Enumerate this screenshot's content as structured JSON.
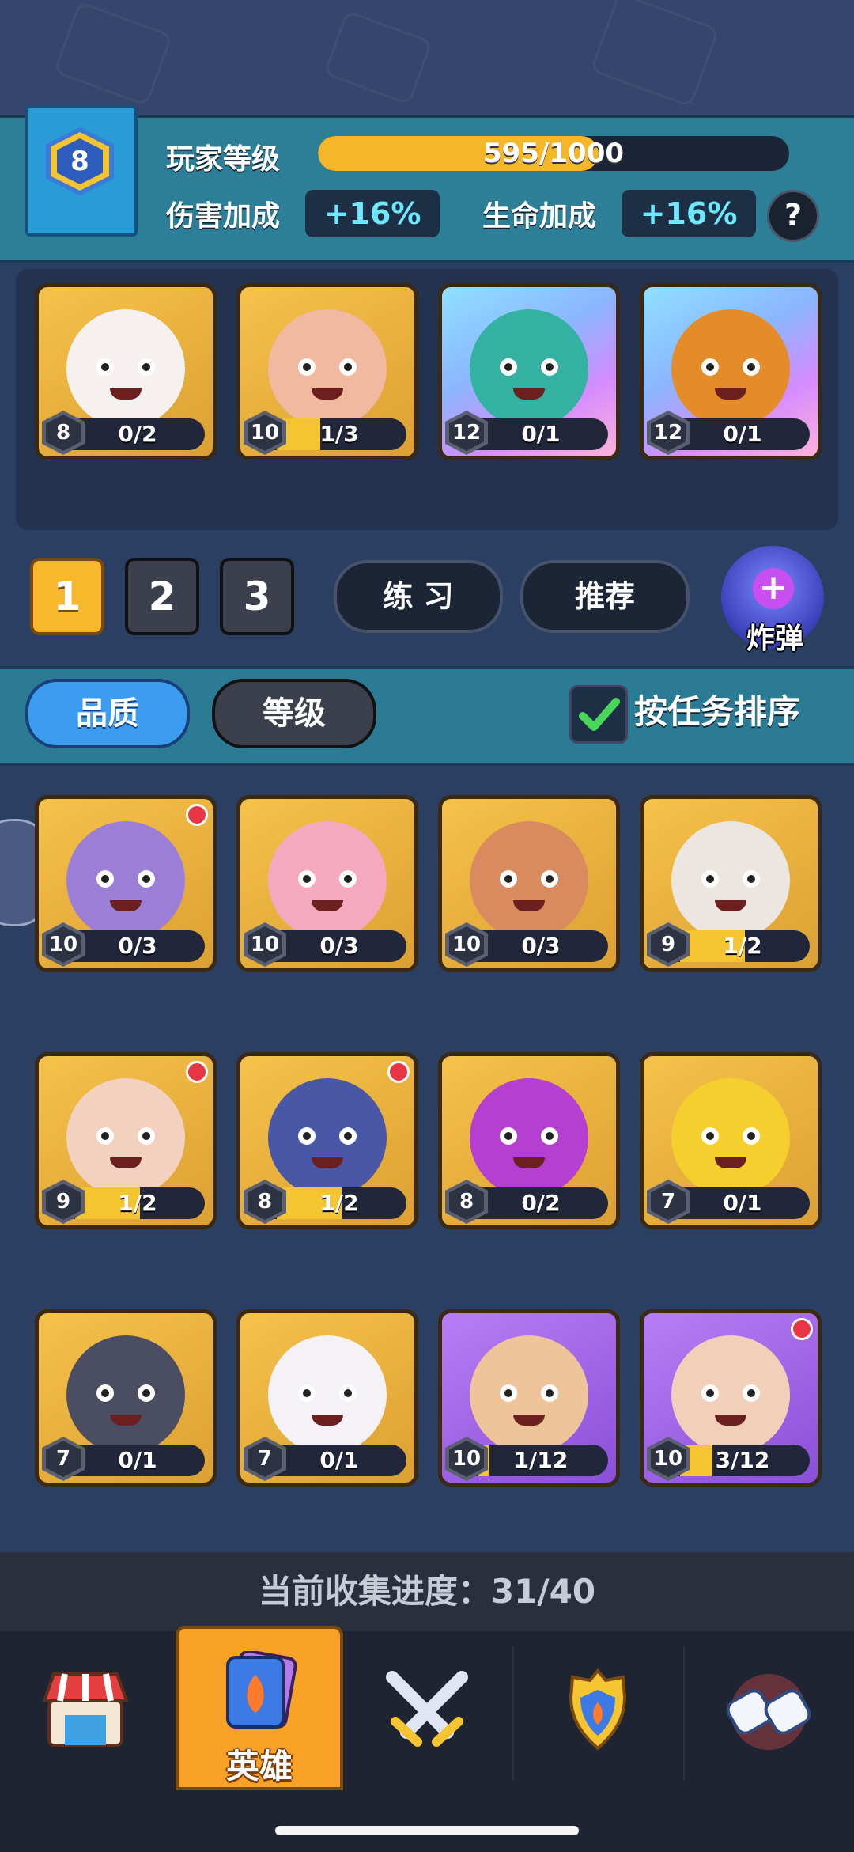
{
  "player": {
    "level": "8",
    "level_label": "玩家等级",
    "xp_text": "595/1000",
    "xp_progress": 0.595,
    "damage_label": "伤害加成",
    "damage_value": "+16%",
    "health_label": "生命加成",
    "health_value": "+16%",
    "help_label": "?"
  },
  "team": [
    {
      "level": "8",
      "count": "0/2",
      "progress": 0,
      "rarity": "gold",
      "color": "#f6f1ee",
      "name_icon": "white-cat-pharaoh-icon"
    },
    {
      "level": "10",
      "count": "1/3",
      "progress": 0.333,
      "rarity": "gold",
      "color": "#f0b9a0",
      "name_icon": "knight-helmet-icon"
    },
    {
      "level": "12",
      "count": "0/1",
      "progress": 0,
      "rarity": "rainbow",
      "color": "#33b2a2",
      "name_icon": "ghost-king-icon"
    },
    {
      "level": "12",
      "count": "0/1",
      "progress": 0,
      "rarity": "rainbow",
      "color": "#e58c2a",
      "name_icon": "pumpkin-magician-icon"
    }
  ],
  "deck_tabs": [
    "1",
    "2",
    "3"
  ],
  "buttons": {
    "practice": "练 习",
    "recommend": "推荐",
    "bomb": "炸弹"
  },
  "filters": {
    "quality": "品质",
    "level": "等级",
    "sort_by_task": "按任务排序"
  },
  "heroes": [
    {
      "level": "10",
      "count": "0/3",
      "progress": 0,
      "rarity": "gold",
      "color": "#9b7ed6",
      "dot": true,
      "name_icon": "vampire-maid-icon"
    },
    {
      "level": "10",
      "count": "0/3",
      "progress": 0,
      "rarity": "gold",
      "color": "#f5a9bf",
      "dot": false,
      "name_icon": "pink-ninja-girl-icon"
    },
    {
      "level": "10",
      "count": "0/3",
      "progress": 0,
      "rarity": "gold",
      "color": "#d98b5f",
      "dot": false,
      "name_icon": "tribal-girl-icon"
    },
    {
      "level": "9",
      "count": "1/2",
      "progress": 0.5,
      "rarity": "gold",
      "color": "#ece6e0",
      "dot": false,
      "name_icon": "masked-shaman-icon"
    },
    {
      "level": "9",
      "count": "1/2",
      "progress": 0.5,
      "rarity": "gold",
      "color": "#f2d2bf",
      "dot": true,
      "name_icon": "old-dwarf-icon"
    },
    {
      "level": "8",
      "count": "1/2",
      "progress": 0.5,
      "rarity": "gold",
      "color": "#4a56a6",
      "dot": true,
      "name_icon": "ice-golem-icon"
    },
    {
      "level": "8",
      "count": "0/2",
      "progress": 0,
      "rarity": "gold",
      "color": "#b43fd0",
      "dot": false,
      "name_icon": "purple-spider-icon"
    },
    {
      "level": "7",
      "count": "0/1",
      "progress": 0,
      "rarity": "gold",
      "color": "#f5cf2e",
      "dot": false,
      "name_icon": "rooster-boxer-icon"
    },
    {
      "level": "7",
      "count": "0/1",
      "progress": 0,
      "rarity": "gold",
      "color": "#4b4d63",
      "dot": false,
      "name_icon": "werewolf-icon"
    },
    {
      "level": "7",
      "count": "0/1",
      "progress": 0,
      "rarity": "gold",
      "color": "#f4f2f7",
      "dot": false,
      "name_icon": "cloud-spirit-icon"
    },
    {
      "level": "10",
      "count": "1/12",
      "progress": 0.083,
      "rarity": "purple",
      "color": "#f0c49b",
      "dot": false,
      "name_icon": "forest-elf-icon"
    },
    {
      "level": "10",
      "count": "3/12",
      "progress": 0.25,
      "rarity": "purple",
      "color": "#f2cfb8",
      "dot": true,
      "name_icon": "ice-queen-icon"
    }
  ],
  "collection": {
    "label": "当前收集进度：31/40"
  },
  "nav": {
    "heroes_label": "英雄"
  }
}
